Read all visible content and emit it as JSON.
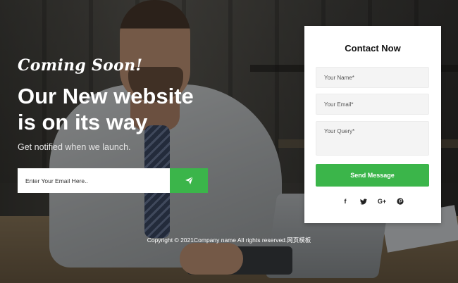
{
  "hero": {
    "coming_soon": "Coming Soon!",
    "headline_line1": "Our New website",
    "headline_line2": "is on its way",
    "subtext": "Get notified when we launch."
  },
  "subscribe": {
    "placeholder": "Enter Your Email Here..",
    "button_icon": "paper-plane-icon"
  },
  "contact": {
    "title": "Contact Now",
    "name_placeholder": "Your Name*",
    "email_placeholder": "Your Email*",
    "query_placeholder": "Your Query*",
    "send_label": "Send Message",
    "socials": [
      {
        "icon": "facebook-icon",
        "glyph": "f"
      },
      {
        "icon": "twitter-icon",
        "glyph": "t"
      },
      {
        "icon": "google-plus-icon",
        "glyph": "G+"
      },
      {
        "icon": "pinterest-icon",
        "glyph": "p"
      }
    ]
  },
  "footer": {
    "copyright": "Copyright © 2021Company name All rights reserved.网页模板"
  },
  "colors": {
    "accent": "#3bb54a",
    "card_bg": "#ffffff"
  }
}
